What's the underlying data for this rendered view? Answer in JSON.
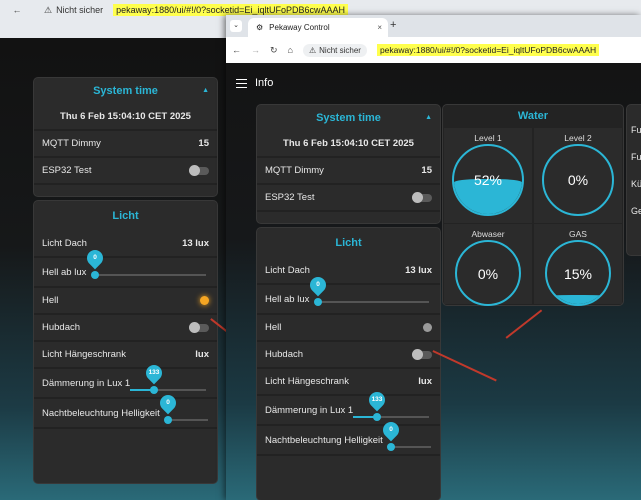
{
  "back": {
    "nav_icon": "back-arrow-icon",
    "security": "Nicht sicher",
    "url": "pekaway:1880/ui/#!/0?socketid=Ei_iqltUFoPDB6cwAAAH",
    "system_time": {
      "title": "System time",
      "datetime": "Thu 6 Feb 15:04:10 CET 2025",
      "mqtt_label": "MQTT Dimmy",
      "mqtt_value": "15",
      "esp_label": "ESP32 Test"
    },
    "licht": {
      "title": "Licht",
      "dach_label": "Licht Dach",
      "dach_value": "13 lux",
      "hell_ab_label": "Hell ab lux",
      "hell_ab_value": "0",
      "hell_label": "Hell",
      "hell_led_color": "#f5a623",
      "hubdach_label": "Hubdach",
      "haeng_label": "Licht Hängeschrank",
      "haeng_value": "lux",
      "daemmerung_label": "Dämmerung in Lux 1",
      "daemmerung_value": "133",
      "nacht_label": "Nachtbeleuchtung Helligkeit",
      "nacht_value": "0"
    }
  },
  "front": {
    "tab_title": "Pekaway Control",
    "tab_close": "×",
    "new_tab": "+",
    "security": "Nicht sicher",
    "url": "pekaway:1880/ui/#!/0?socketid=Ei_iqltUFoPDB6cwAAAH",
    "page_title": "Info",
    "system_time": {
      "title": "System time",
      "datetime": "Thu 6 Feb 15:04:10 CET 2025",
      "mqtt_label": "MQTT Dimmy",
      "mqtt_value": "15",
      "esp_label": "ESP32 Test"
    },
    "licht": {
      "title": "Licht",
      "dach_label": "Licht Dach",
      "dach_value": "13 lux",
      "hell_ab_label": "Hell ab lux",
      "hell_ab_value": "0",
      "hell_label": "Hell",
      "hell_led_color": "#9a9a9a",
      "hubdach_label": "Hubdach",
      "haeng_label": "Licht Hängeschrank",
      "haeng_value": "lux",
      "daemmerung_label": "Dämmerung in Lux 1",
      "daemmerung_value": "133",
      "nacht_label": "Nachtbeleuchtung Helligkeit",
      "nacht_value": "0"
    },
    "water": {
      "title": "Water",
      "gauges": [
        {
          "label": "Level 1",
          "value": "52%",
          "fill": 0.52
        },
        {
          "label": "Level 2",
          "value": "0%",
          "fill": 0.0
        },
        {
          "label": "Abwaser",
          "value": "0%",
          "fill": 0.0
        },
        {
          "label": "GAS",
          "value": "15%",
          "fill": 0.15
        }
      ]
    },
    "right_edge_labels": [
      "Fu",
      "Fu",
      "Kü",
      "Ge"
    ]
  },
  "colors": {
    "accent": "#2bb6d6",
    "highlight": "#ffff4d",
    "arrow": "#c0392b"
  }
}
